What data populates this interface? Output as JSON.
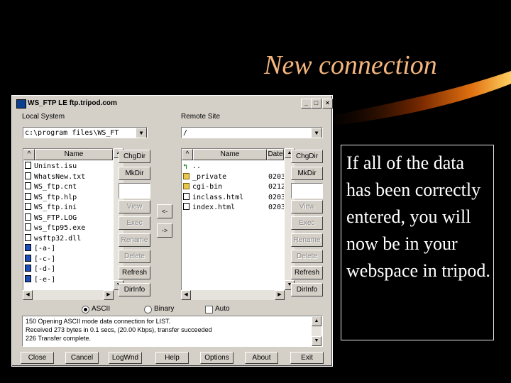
{
  "slide": {
    "title": "New connection",
    "body": "If all of the data has been correctly entered, you will now be in your webspace in tripod."
  },
  "window": {
    "title": "WS_FTP LE ftp.tripod.com",
    "controls": [
      "_",
      "□",
      "×"
    ]
  },
  "local": {
    "label": "Local System",
    "path": "c:\\program files\\WS_FT",
    "col_up": "^",
    "col_name": "Name",
    "files": [
      {
        "name": "Uninst.isu",
        "icon": "doc-icon"
      },
      {
        "name": "WhatsNew.txt",
        "icon": "doc-icon"
      },
      {
        "name": "WS_ftp.cnt",
        "icon": "doc-icon"
      },
      {
        "name": "WS_ftp.hlp",
        "icon": "doc-icon"
      },
      {
        "name": "WS_ftp.ini",
        "icon": "doc-icon"
      },
      {
        "name": "WS_FTP.LOG",
        "icon": "doc-icon"
      },
      {
        "name": "ws_ftp95.exe",
        "icon": "doc-icon"
      },
      {
        "name": "wsftp32.dll",
        "icon": "doc-icon"
      },
      {
        "name": "[-a-]",
        "icon": "drive-icon"
      },
      {
        "name": "[-c-]",
        "icon": "drive-icon"
      },
      {
        "name": "[-d-]",
        "icon": "drive-icon"
      },
      {
        "name": "[-e-]",
        "icon": "drive-icon"
      }
    ],
    "buttons": [
      "ChgDir",
      "MkDir",
      "View",
      "Exec",
      "Rename",
      "Delete",
      "Refresh",
      "DirInfo"
    ]
  },
  "remote": {
    "label": "Remote Site",
    "path": "/",
    "col_up": "^",
    "col_name": "Name",
    "col_date": "Date",
    "files": [
      {
        "name": "..",
        "date": "",
        "icon": "up-icon"
      },
      {
        "name": "_private",
        "date": "0203",
        "icon": "folder-icon"
      },
      {
        "name": "cgi-bin",
        "date": "0212",
        "icon": "folder-icon"
      },
      {
        "name": "inclass.html",
        "date": "0203",
        "icon": "doc-icon"
      },
      {
        "name": "index.html",
        "date": "0203",
        "icon": "doc-icon"
      }
    ],
    "buttons": [
      "ChgDir",
      "MkDir",
      "View",
      "Exec",
      "Rename",
      "Delete",
      "Refresh",
      "DirInfo"
    ]
  },
  "transfer": {
    "left": "<-",
    "right": "->"
  },
  "mode": {
    "ascii": "ASCII",
    "binary": "Binary",
    "auto": "Auto",
    "selected": "ASCII"
  },
  "log": [
    "150 Opening ASCII mode data connection for LIST.",
    "Received 273 bytes in 0.1 secs, (20.00 Kbps), transfer succeeded",
    "226 Transfer complete."
  ],
  "bottom_buttons": [
    "Close",
    "Cancel",
    "LogWnd",
    "Help",
    "Options",
    "About",
    "Exit"
  ]
}
